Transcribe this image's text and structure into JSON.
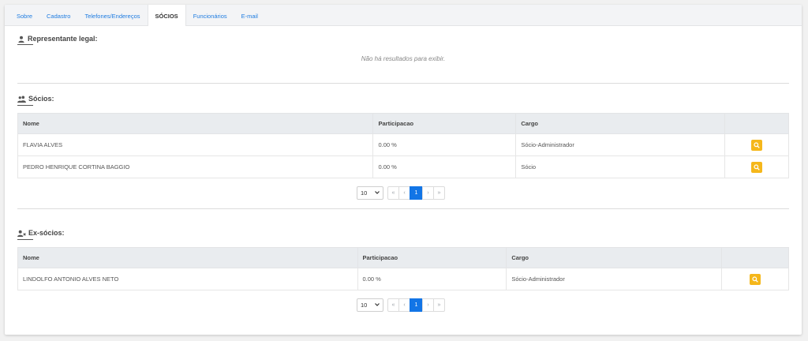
{
  "tabs": [
    {
      "label": "Sobre"
    },
    {
      "label": "Cadastro"
    },
    {
      "label": "Telefones/Endereços"
    },
    {
      "label": "SÓCIOS"
    },
    {
      "label": "Funcionários"
    },
    {
      "label": "E-mail"
    }
  ],
  "active_tab": "SÓCIOS",
  "representante": {
    "title": "Representante legal:",
    "icon": "user-icon",
    "empty_message": "Não há resultados para exibir."
  },
  "socios": {
    "title": "Sócios:",
    "icon": "users-icon",
    "columns": [
      "Nome",
      "Participacao",
      "Cargo"
    ],
    "rows": [
      {
        "nome": "FLAVIA ALVES",
        "participacao": "0.00 %",
        "cargo": "Sócio-Administrador"
      },
      {
        "nome": "PEDRO HENRIQUE CORTINA BAGGIO",
        "participacao": "0.00 %",
        "cargo": "Sócio"
      }
    ],
    "pager": {
      "page_size": "10",
      "first": "«",
      "prev": "‹",
      "current": "1",
      "next": "›",
      "last": "»"
    }
  },
  "ex_socios": {
    "title": "Ex-sócios:",
    "icon": "user-times-icon",
    "columns": [
      "Nome",
      "Participacao",
      "Cargo"
    ],
    "rows": [
      {
        "nome": "LINDOLFO ANTONIO ALVES NETO",
        "participacao": "0.00 %",
        "cargo": "Sócio-Administrador"
      }
    ],
    "pager": {
      "page_size": "10",
      "first": "«",
      "prev": "‹",
      "current": "1",
      "next": "›",
      "last": "»"
    }
  },
  "colors": {
    "accent": "#1275e6",
    "action_button": "#f5b71b",
    "tab_text": "#1f7ce0"
  }
}
